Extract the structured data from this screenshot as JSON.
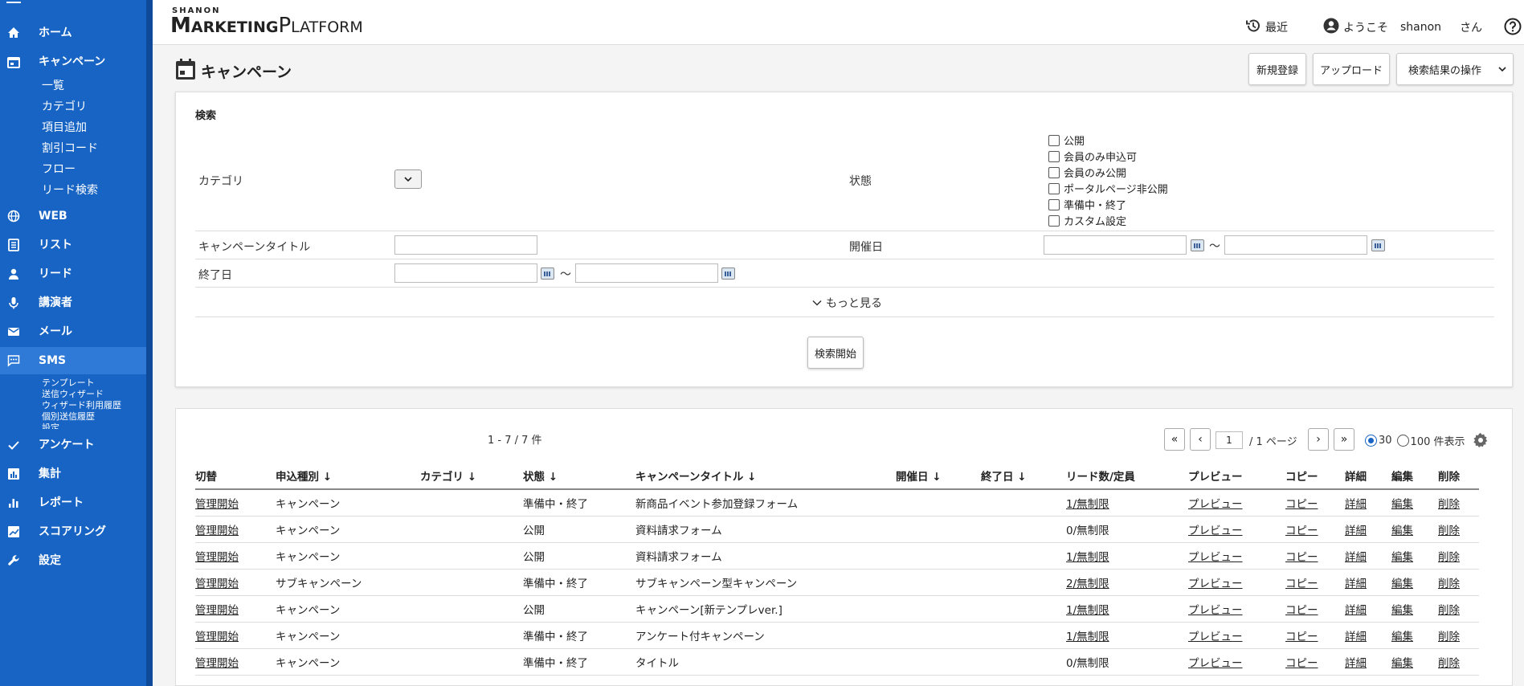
{
  "brand": {
    "top": "SHANON",
    "main_big1": "M",
    "main_small1": "ARKETING",
    "main_big2": "P",
    "main_small2": "LATFORM"
  },
  "topbar": {
    "recent": "最近",
    "welcome": "ようこそ",
    "user": "shanon",
    "san": "さん"
  },
  "sidebar": {
    "nav": [
      {
        "label": "ホーム",
        "icon": "home-icon"
      },
      {
        "label": "キャンペーン",
        "icon": "calendar-icon"
      },
      {
        "label": "WEB",
        "icon": "globe-icon"
      },
      {
        "label": "リスト",
        "icon": "list-icon"
      },
      {
        "label": "リード",
        "icon": "person-icon"
      },
      {
        "label": "講演者",
        "icon": "microphone-icon"
      },
      {
        "label": "メール",
        "icon": "mail-icon"
      },
      {
        "label": "SMS",
        "icon": "chat-icon"
      },
      {
        "label": "アンケート",
        "icon": "check-icon"
      },
      {
        "label": "集計",
        "icon": "bar-chart-icon"
      },
      {
        "label": "レポート",
        "icon": "report-icon"
      },
      {
        "label": "スコアリング",
        "icon": "scoring-icon"
      },
      {
        "label": "設定",
        "icon": "wrench-icon"
      }
    ],
    "campaign_sub": [
      "一覧",
      "カテゴリ",
      "項目追加",
      "割引コード",
      "フロー",
      "リード検索"
    ],
    "sms_sub": [
      "テンプレート",
      "送信ウィザード",
      "ウィザード利用履歴",
      "個別送信履歴",
      "設定"
    ]
  },
  "page": {
    "title": "キャンペーン",
    "new_button": "新規登録",
    "upload_button": "アップロード",
    "ops_select": "検索結果の操作"
  },
  "search": {
    "title": "検索",
    "category_label": "カテゴリ",
    "status_label": "状態",
    "status_options": [
      "公開",
      "会員のみ申込可",
      "会員のみ公開",
      "ポータルページ非公開",
      "準備中・終了",
      "カスタム設定"
    ],
    "campaign_title_label": "キャンペーンタイトル",
    "start_date_label": "開催日",
    "end_date_label": "終了日",
    "tilde": "〜",
    "more": "もっと見る",
    "search_button": "検索開始"
  },
  "results": {
    "count": "1 - 7 / 7 件",
    "page_value": "1",
    "page_total": "/ 1 ページ",
    "first": "«",
    "prev": "‹",
    "next": "›",
    "last": "»",
    "per_page_30": "30",
    "per_page_100": "100 件表示",
    "columns": [
      "切替",
      "申込種別 ↓",
      "カテゴリ ↓",
      "状態 ↓",
      "キャンペーンタイトル ↓",
      "開催日 ↓",
      "終了日 ↓",
      "リード数/定員",
      "プレビュー",
      "コピー",
      "詳細",
      "編集",
      "削除"
    ],
    "rows": [
      {
        "switch": "管理開始",
        "type": "キャンペーン",
        "category": "",
        "status": "準備中・終了",
        "title": "新商品イベント参加登録フォーム",
        "start": "",
        "end": "",
        "leads": "1/無制限",
        "leads_link": true,
        "preview": "プレビュー",
        "copy": "コピー",
        "detail": "詳細",
        "edit": "編集",
        "delete": "削除"
      },
      {
        "switch": "管理開始",
        "type": "キャンペーン",
        "category": "",
        "status": "公開",
        "title": "資料請求フォーム",
        "start": "",
        "end": "",
        "leads": "0/無制限",
        "leads_link": false,
        "preview": "プレビュー",
        "copy": "コピー",
        "detail": "詳細",
        "edit": "編集",
        "delete": "削除"
      },
      {
        "switch": "管理開始",
        "type": "キャンペーン",
        "category": "",
        "status": "公開",
        "title": "資料請求フォーム",
        "start": "",
        "end": "",
        "leads": "1/無制限",
        "leads_link": true,
        "preview": "プレビュー",
        "copy": "コピー",
        "detail": "詳細",
        "edit": "編集",
        "delete": "削除"
      },
      {
        "switch": "管理開始",
        "type": "サブキャンペーン",
        "category": "",
        "status": "準備中・終了",
        "title": "サブキャンペーン型キャンペーン",
        "start": "",
        "end": "",
        "leads": "2/無制限",
        "leads_link": true,
        "preview": "プレビュー",
        "copy": "コピー",
        "detail": "詳細",
        "edit": "編集",
        "delete": "削除"
      },
      {
        "switch": "管理開始",
        "type": "キャンペーン",
        "category": "",
        "status": "公開",
        "title": "キャンペーン[新テンプレver.]",
        "start": "",
        "end": "",
        "leads": "1/無制限",
        "leads_link": true,
        "preview": "プレビュー",
        "copy": "コピー",
        "detail": "詳細",
        "edit": "編集",
        "delete": "削除"
      },
      {
        "switch": "管理開始",
        "type": "キャンペーン",
        "category": "",
        "status": "準備中・終了",
        "title": "アンケート付キャンペーン",
        "start": "",
        "end": "",
        "leads": "1/無制限",
        "leads_link": true,
        "preview": "プレビュー",
        "copy": "コピー",
        "detail": "詳細",
        "edit": "編集",
        "delete": "削除"
      },
      {
        "switch": "管理開始",
        "type": "キャンペーン",
        "category": "",
        "status": "準備中・終了",
        "title": "タイトル",
        "start": "",
        "end": "",
        "leads": "0/無制限",
        "leads_link": false,
        "preview": "プレビュー",
        "copy": "コピー",
        "detail": "詳細",
        "edit": "編集",
        "削除": "",
        "delete": "削除"
      }
    ]
  },
  "colors": {
    "sidebar": "#1764c4",
    "sidebar_active": "#2f7ad6",
    "accent": "#1764c4"
  }
}
